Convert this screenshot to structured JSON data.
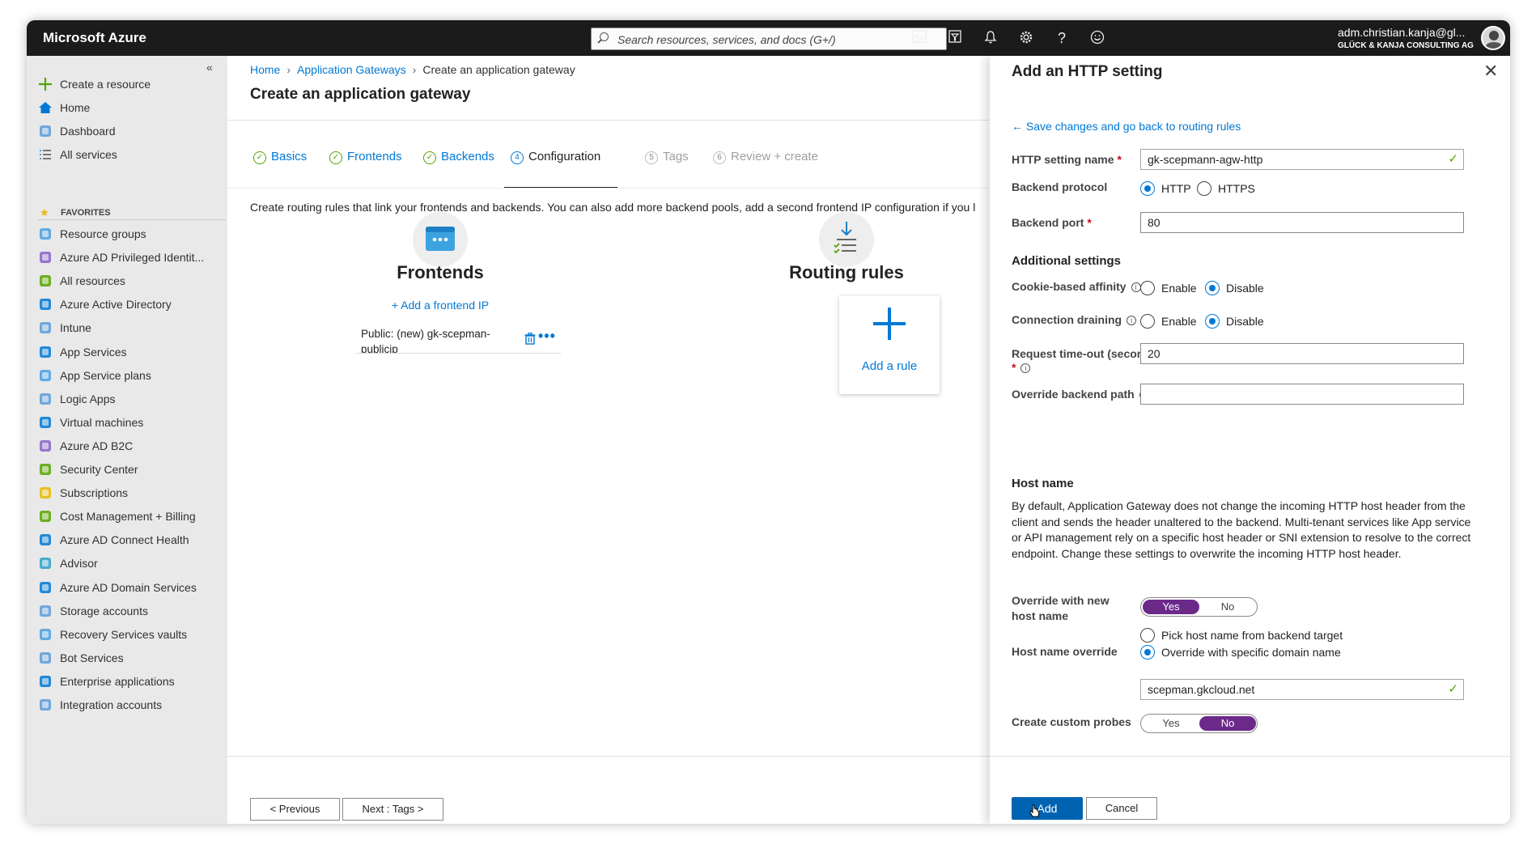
{
  "topbar": {
    "brand": "Microsoft Azure",
    "search_placeholder": "Search resources, services, and docs (G+/)",
    "account_name": "adm.christian.kanja@gl...",
    "account_org": "GLÜCK & KANJA CONSULTING AG",
    "icons": [
      "cloud-shell-icon",
      "directory-filter-icon",
      "notifications-icon",
      "settings-icon",
      "help-icon",
      "feedback-icon"
    ]
  },
  "sidebar": {
    "collapse_glyph": "«",
    "top_items": [
      {
        "label": "Create a resource",
        "icon": "plus-icon",
        "color": "#57a300"
      },
      {
        "label": "Home",
        "icon": "home-icon",
        "color": "#0078d4"
      },
      {
        "label": "Dashboard",
        "icon": "dashboard-icon",
        "color": "#5c9bd6"
      },
      {
        "label": "All services",
        "icon": "list-icon",
        "color": "#5c9bd6"
      }
    ],
    "favorites_label": "FAVORITES",
    "favorites": [
      {
        "label": "Resource groups",
        "icon": "resource-groups-icon",
        "color": "#4a9fe0"
      },
      {
        "label": "Azure AD Privileged Identit...",
        "icon": "privileged-identity-icon",
        "color": "#8661c5"
      },
      {
        "label": "All resources",
        "icon": "all-resources-icon",
        "color": "#57a300"
      },
      {
        "label": "Azure Active Directory",
        "icon": "active-directory-icon",
        "color": "#0078d4"
      },
      {
        "label": "Intune",
        "icon": "intune-icon",
        "color": "#5c9bd6"
      },
      {
        "label": "App Services",
        "icon": "app-services-icon",
        "color": "#0078d4"
      },
      {
        "label": "App Service plans",
        "icon": "app-service-plans-icon",
        "color": "#4a9fe0"
      },
      {
        "label": "Logic Apps",
        "icon": "logic-apps-icon",
        "color": "#5c9bd6"
      },
      {
        "label": "Virtual machines",
        "icon": "virtual-machines-icon",
        "color": "#0078d4"
      },
      {
        "label": "Azure AD B2C",
        "icon": "b2c-icon",
        "color": "#8661c5"
      },
      {
        "label": "Security Center",
        "icon": "security-center-icon",
        "color": "#57a300"
      },
      {
        "label": "Subscriptions",
        "icon": "subscriptions-icon",
        "color": "#e8b900"
      },
      {
        "label": "Cost Management + Billing",
        "icon": "cost-management-icon",
        "color": "#57a300"
      },
      {
        "label": "Azure AD Connect Health",
        "icon": "connect-health-icon",
        "color": "#0078d4"
      },
      {
        "label": "Advisor",
        "icon": "advisor-icon",
        "color": "#2aa0c8"
      },
      {
        "label": "Azure AD Domain Services",
        "icon": "domain-services-icon",
        "color": "#0078d4"
      },
      {
        "label": "Storage accounts",
        "icon": "storage-accounts-icon",
        "color": "#5c9bd6"
      },
      {
        "label": "Recovery Services vaults",
        "icon": "recovery-vaults-icon",
        "color": "#4a9fe0"
      },
      {
        "label": "Bot Services",
        "icon": "bot-services-icon",
        "color": "#5c9bd6"
      },
      {
        "label": "Enterprise applications",
        "icon": "enterprise-apps-icon",
        "color": "#0078d4"
      },
      {
        "label": "Integration accounts",
        "icon": "integration-accounts-icon",
        "color": "#5c9bd6"
      }
    ]
  },
  "main": {
    "breadcrumb": [
      "Home",
      "Application Gateways",
      "Create an application gateway"
    ],
    "title": "Create an application gateway",
    "tabs": [
      {
        "label": "Basics",
        "state": "done"
      },
      {
        "label": "Frontends",
        "state": "done"
      },
      {
        "label": "Backends",
        "state": "done"
      },
      {
        "label": "Configuration",
        "number": "4",
        "state": "active"
      },
      {
        "label": "Tags",
        "number": "5",
        "state": "disabled"
      },
      {
        "label": "Review + create",
        "number": "6",
        "state": "disabled"
      }
    ],
    "description": "Create routing rules that link your frontends and backends. You can also add more backend pools, add a second frontend IP configuration if you l",
    "frontends": {
      "title": "Frontends",
      "add_link": "+ Add a frontend IP",
      "item": "Public: (new) gk-scepman-publicip"
    },
    "routing": {
      "title": "Routing rules",
      "add_rule": "Add a rule"
    },
    "buttons": {
      "previous": "< Previous",
      "next": "Next : Tags >"
    }
  },
  "panel": {
    "title": "Add an HTTP setting",
    "close_glyph": "✕",
    "back_link": "← Save changes and go back to routing rules",
    "http_setting_name": {
      "label": "HTTP setting name",
      "value": "gk-scepmann-agw-http"
    },
    "backend_protocol": {
      "label": "Backend protocol",
      "options": [
        "HTTP",
        "HTTPS"
      ],
      "selected": "HTTP"
    },
    "backend_port": {
      "label": "Backend port",
      "value": "80"
    },
    "additional_settings": "Additional settings",
    "cookie_affinity": {
      "label": "Cookie-based affinity",
      "options": [
        "Enable",
        "Disable"
      ],
      "selected": "Disable"
    },
    "connection_draining": {
      "label": "Connection draining",
      "options": [
        "Enable",
        "Disable"
      ],
      "selected": "Disable"
    },
    "request_timeout": {
      "label": "Request time-out (seconds)",
      "value": "20"
    },
    "override_path": {
      "label": "Override backend path",
      "value": ""
    },
    "host_name_heading": "Host name",
    "host_name_description": "By default, Application Gateway does not change the incoming HTTP host header from the client and sends the header unaltered to the backend. Multi-tenant services like App service or API management rely on a specific host header or SNI extension to resolve to the correct endpoint. Change these settings to overwrite the incoming HTTP host header.",
    "override_host": {
      "label": "Override with new host name",
      "options": [
        "Yes",
        "No"
      ],
      "selected": "Yes"
    },
    "host_name_override": {
      "label": "Host name override",
      "options": [
        "Pick host name from backend target",
        "Override with specific domain name"
      ],
      "selected": "Override with specific domain name",
      "value": "scepman.gkcloud.net"
    },
    "custom_probes": {
      "label": "Create custom probes",
      "options": [
        "Yes",
        "No"
      ],
      "selected": "No"
    },
    "add_button": "Add",
    "cancel_button": "Cancel"
  }
}
